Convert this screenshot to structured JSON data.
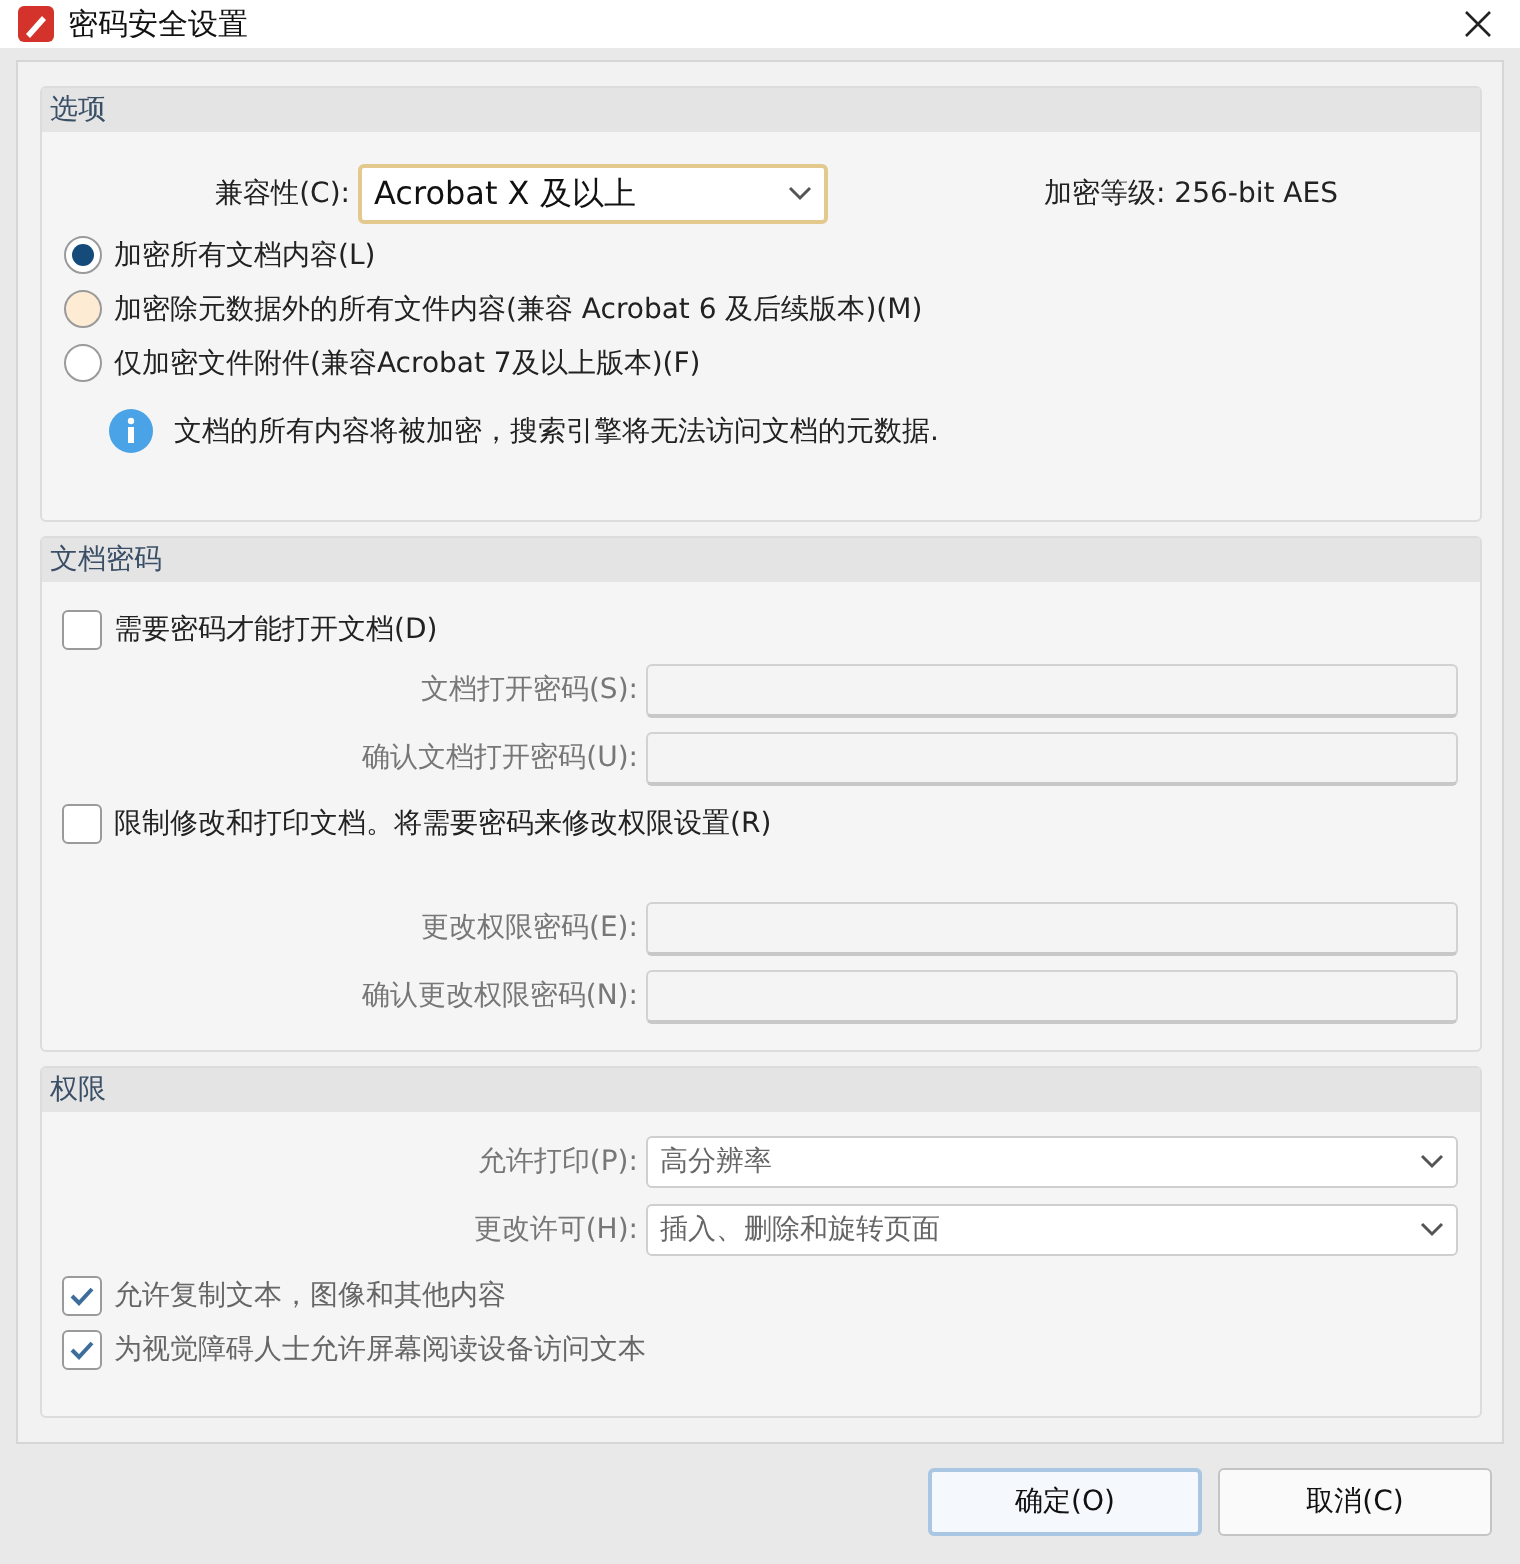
{
  "window": {
    "title": "密码安全设置"
  },
  "options": {
    "heading": "选项",
    "compatibility": {
      "label": "兼容性(C):",
      "value": "Acrobat X 及以上",
      "focused": true
    },
    "encryption_level": "加密等级:  256-bit AES",
    "radios": [
      {
        "label": "加密所有文档内容(L)",
        "selected": true,
        "hovered": false
      },
      {
        "label": "加密除元数据外的所有文件内容(兼容 Acrobat 6 及后续版本)(M)",
        "selected": false,
        "hovered": true
      },
      {
        "label": "仅加密文件附件(兼容Acrobat 7及以上版本)(F)",
        "selected": false,
        "hovered": false
      }
    ],
    "info": "文档的所有内容将被加密，搜索引擎将无法访问文档的元数据."
  },
  "document_password": {
    "heading": "文档密码",
    "groups": [
      {
        "label": "需要密码才能打开文档(D)",
        "checked": false,
        "fields": [
          {
            "label": "文档打开密码(S):",
            "disabled": true
          },
          {
            "label": "确认文档打开密码(U):",
            "disabled": true
          }
        ]
      },
      {
        "label": "限制修改和打印文档。将需要密码来修改权限设置(R)",
        "checked": false,
        "fields": [
          {
            "label": "更改权限密码(E):",
            "disabled": true
          },
          {
            "label": "确认更改权限密码(N):",
            "disabled": true
          }
        ]
      }
    ]
  },
  "permissions": {
    "heading": "权限",
    "disabled": true,
    "selects": [
      {
        "label": "允许打印(P):",
        "value": "高分辨率"
      },
      {
        "label": "更改许可(H):",
        "value": "插入、删除和旋转页面"
      }
    ],
    "checkboxes": [
      {
        "label": "允许复制文本，图像和其他内容",
        "checked": true
      },
      {
        "label": "为视觉障碍人士允许屏幕阅读设备访问文本",
        "checked": true
      }
    ]
  },
  "buttons": [
    {
      "label": "确定(O)",
      "default": true
    },
    {
      "label": "取消(C)",
      "default": false
    }
  ]
}
